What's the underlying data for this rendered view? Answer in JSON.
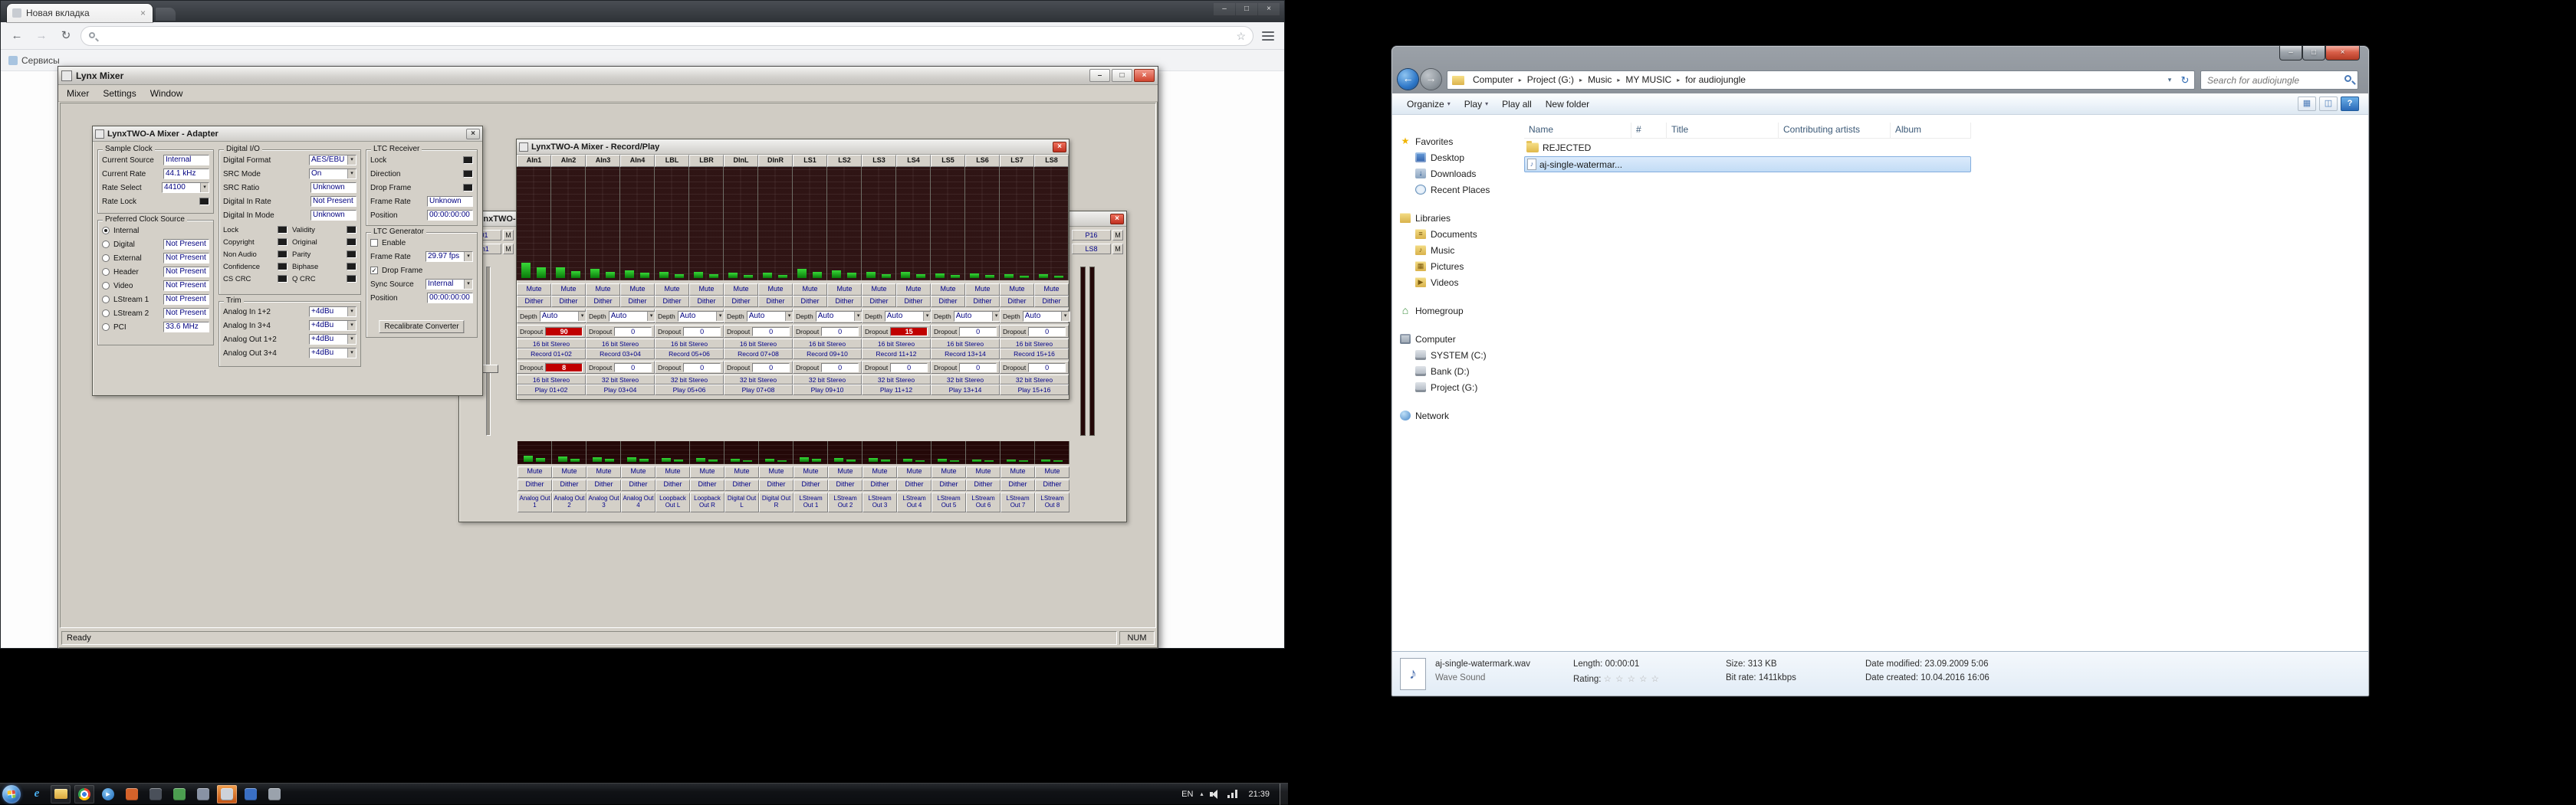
{
  "icons": {
    "close": "×",
    "minimize": "–",
    "maximize": "□",
    "back": "←",
    "forward": "→",
    "refresh": "↻",
    "star": "☆",
    "dropdown": "▾",
    "crumb_sep": "▸",
    "tray_chevron": "▴",
    "check": "✓",
    "note": "♪"
  },
  "browser": {
    "tab_title": "Новая вкладка",
    "bookmark": "Сервисы",
    "address_value": ""
  },
  "mixer": {
    "title": "Lynx Mixer",
    "menu": [
      "Mixer",
      "Settings",
      "Window"
    ],
    "status": {
      "ready": "Ready",
      "num": "NUM"
    },
    "adapter": {
      "title": "LynxTWO-A Mixer - Adapter",
      "groups": {
        "sample_clock": {
          "title": "Sample Clock",
          "rows": [
            {
              "label": "Current Source",
              "value": "Internal",
              "kind": "box"
            },
            {
              "label": "Current Rate",
              "value": "44.1 kHz",
              "kind": "box"
            },
            {
              "label": "Rate Select",
              "value": "44100",
              "kind": "combo"
            },
            {
              "label": "Rate Lock",
              "kind": "led"
            }
          ]
        },
        "preferred": {
          "title": "Preferred Clock Source",
          "rows": [
            {
              "label": "Internal",
              "kind": "radio",
              "selected": true
            },
            {
              "label": "Digital",
              "kind": "radio",
              "value": "Not Present"
            },
            {
              "label": "External",
              "kind": "radio",
              "value": "Not Present"
            },
            {
              "label": "Header",
              "kind": "radio",
              "value": "Not Present"
            },
            {
              "label": "Video",
              "kind": "radio",
              "value": "Not Present"
            },
            {
              "label": "LStream 1",
              "kind": "radio",
              "value": "Not Present"
            },
            {
              "label": "LStream 2",
              "kind": "radio",
              "value": "Not Present"
            },
            {
              "label": "PCI",
              "kind": "radio",
              "value": "33.6 MHz"
            }
          ]
        },
        "digital_io": {
          "title": "Digital I/O",
          "rows": [
            {
              "label": "Digital Format",
              "value": "AES/EBU",
              "kind": "combo"
            },
            {
              "label": "SRC Mode",
              "value": "On",
              "kind": "combo"
            },
            {
              "label": "SRC Ratio",
              "value": "Unknown",
              "kind": "box"
            },
            {
              "label": "Digital In Rate",
              "value": "Not Present",
              "kind": "box"
            },
            {
              "label": "Digital In Mode",
              "value": "Unknown",
              "kind": "box"
            }
          ],
          "leds": [
            [
              "Lock",
              "Validity"
            ],
            [
              "Copyright",
              "Original"
            ],
            [
              "Non Audio",
              "Parity"
            ],
            [
              "Confidence",
              "Biphase"
            ],
            [
              "CS CRC",
              "Q CRC"
            ]
          ]
        },
        "trim": {
          "title": "Trim",
          "rows": [
            {
              "label": "Analog In 1+2",
              "value": "+4dBu",
              "kind": "combo"
            },
            {
              "label": "Analog In 3+4",
              "value": "+4dBu",
              "kind": "combo"
            },
            {
              "label": "Analog Out 1+2",
              "value": "+4dBu",
              "kind": "combo"
            },
            {
              "label": "Analog Out 3+4",
              "value": "+4dBu",
              "kind": "combo"
            }
          ]
        },
        "ltc_receiver": {
          "title": "LTC Receiver",
          "rows": [
            {
              "label": "Lock",
              "kind": "led"
            },
            {
              "label": "Direction",
              "kind": "led"
            },
            {
              "label": "Drop Frame",
              "kind": "led"
            },
            {
              "label": "Frame Rate",
              "value": "Unknown",
              "kind": "box"
            },
            {
              "label": "Position",
              "value": "00:00:00:00",
              "kind": "box"
            }
          ]
        },
        "ltc_generator": {
          "title": "LTC Generator",
          "rows": [
            {
              "label": "Enable",
              "kind": "check",
              "checked": false
            },
            {
              "label": "Frame Rate",
              "value": "29.97 fps",
              "kind": "combo"
            },
            {
              "label": "Drop Frame",
              "kind": "check",
              "checked": true
            },
            {
              "label": "Sync Source",
              "value": "Internal",
              "kind": "combo"
            },
            {
              "label": "Position",
              "value": "00:00:00:00",
              "kind": "box"
            }
          ],
          "button": "Recalibrate Converter"
        }
      }
    },
    "record_play": {
      "title": "LynxTWO-A Mixer - Record/Play",
      "channels": [
        "AIn1",
        "AIn2",
        "AIn3",
        "AIn4",
        "LBL",
        "LBR",
        "DInL",
        "DInR",
        "LS1",
        "LS2",
        "LS3",
        "LS4",
        "LS5",
        "LS6",
        "LS7",
        "LS8"
      ],
      "meter_levels": [
        20,
        14,
        12,
        10,
        8,
        8,
        7,
        7,
        12,
        10,
        8,
        8,
        6,
        6,
        5,
        5
      ],
      "mute_label": "Mute",
      "dither_label": "Dither",
      "depth_label": "Depth",
      "depth_value": "Auto",
      "dropout_label": "Dropout",
      "record": {
        "dropouts": [
          "90",
          "0",
          "0",
          "0",
          "0",
          "15",
          "0",
          "0"
        ],
        "alerts": [
          true,
          false,
          false,
          false,
          false,
          true,
          false,
          false
        ],
        "formats": [
          "16 bit Stereo",
          "16 bit Stereo",
          "16 bit Stereo",
          "16 bit Stereo",
          "16 bit Stereo",
          "16 bit Stereo",
          "16 bit Stereo",
          "16 bit Stereo"
        ],
        "pairs": [
          "Record 01+02",
          "Record 03+04",
          "Record 05+06",
          "Record 07+08",
          "Record 09+10",
          "Record 11+12",
          "Record 13+14",
          "Record 15+16"
        ]
      },
      "play": {
        "dropouts": [
          "8",
          "0",
          "0",
          "0",
          "0",
          "0",
          "0",
          "0"
        ],
        "alerts": [
          true,
          false,
          false,
          false,
          false,
          false,
          false,
          false
        ],
        "formats": [
          "16 bit Stereo",
          "32 bit Stereo",
          "32 bit Stereo",
          "32 bit Stereo",
          "32 bit Stereo",
          "32 bit Stereo",
          "32 bit Stereo",
          "32 bit Stereo"
        ],
        "pairs": [
          "Play 01+02",
          "Play 03+04",
          "Play 05+06",
          "Play 07+08",
          "Play 09+10",
          "Play 11+12",
          "Play 13+14",
          "Play 15+16"
        ]
      }
    },
    "outputs": {
      "title": "LynxTWO-A Mixer",
      "left_tags": [
        "P01",
        "AIn1"
      ],
      "right_tags": [
        "P16",
        "LS8"
      ],
      "m_label": "M",
      "mute_label": "Mute",
      "dither_label": "Dither",
      "labels": [
        "Analog Out 1",
        "Analog Out 2",
        "Analog Out 3",
        "Analog Out 4",
        "Loopback Out L",
        "Loopback Out R",
        "Digital Out L",
        "Digital Out R",
        "LStream Out 1",
        "LStream Out 2",
        "LStream Out 3",
        "LStream Out 4",
        "LStream Out 5",
        "LStream Out 6",
        "LStream Out 7",
        "LStream Out 8"
      ],
      "meter_levels": [
        8,
        7,
        6,
        6,
        5,
        5,
        4,
        4,
        6,
        5,
        5,
        4,
        4,
        3,
        3,
        3
      ]
    }
  },
  "explorer": {
    "breadcrumb": [
      "Computer",
      "Project (G:)",
      "Music",
      "MY MUSIC",
      "for audiojungle"
    ],
    "search_placeholder": "Search for audiojungle",
    "toolbar": {
      "organize": "Organize",
      "play": "Play",
      "play_all": "Play all",
      "new_folder": "New folder"
    },
    "columns": [
      "Name",
      "#",
      "Title",
      "Contributing artists",
      "Album"
    ],
    "items": [
      {
        "name": "REJECTED",
        "icon": "folder",
        "selected": false
      },
      {
        "name": "aj-single-watermar...",
        "icon": "audio",
        "selected": true
      }
    ],
    "nav": [
      {
        "label": "Favorites",
        "icon": "star",
        "level": 0
      },
      {
        "label": "Desktop",
        "icon": "desktop",
        "level": 1
      },
      {
        "label": "Downloads",
        "icon": "downloads",
        "level": 1
      },
      {
        "label": "Recent Places",
        "icon": "recent",
        "level": 1
      },
      {
        "label": "Libraries",
        "icon": "library",
        "level": 0,
        "gap": true
      },
      {
        "label": "Documents",
        "icon": "fold-docs",
        "level": 1
      },
      {
        "label": "Music",
        "icon": "fold-music",
        "level": 1
      },
      {
        "label": "Pictures",
        "icon": "fold-pics",
        "level": 1
      },
      {
        "label": "Videos",
        "icon": "fold-videos",
        "level": 1
      },
      {
        "label": "Homegroup",
        "icon": "home",
        "level": 0,
        "gap": true
      },
      {
        "label": "Computer",
        "icon": "computer",
        "level": 0,
        "gap": true
      },
      {
        "label": "SYSTEM (C:)",
        "icon": "drive",
        "level": 1
      },
      {
        "label": "Bank (D:)",
        "icon": "drive",
        "level": 1
      },
      {
        "label": "Project (G:)",
        "icon": "drive",
        "level": 1
      },
      {
        "label": "Network",
        "icon": "network",
        "level": 0,
        "gap": true
      }
    ],
    "details": {
      "name": "aj-single-watermark.wav",
      "type": "Wave Sound",
      "length": "Length: 00:00:01",
      "rating": "Rating:",
      "stars": "☆ ☆ ☆ ☆ ☆",
      "size": "Size: 313 KB",
      "bitrate": "Bit rate: 1411kbps",
      "modified": "Date modified: 23.09.2009 5:06",
      "created": "Date created: 10.04.2016 16:06"
    }
  },
  "taskbar": {
    "lang": "EN",
    "clock": "21:39",
    "icons": [
      {
        "name": "internet-explorer",
        "kind": "ie",
        "glyph": "e"
      },
      {
        "name": "file-explorer",
        "kind": "folder",
        "state": "running"
      },
      {
        "name": "chrome",
        "kind": "chrome",
        "state": "running"
      },
      {
        "name": "media-player",
        "kind": "player",
        "glyph": "▶"
      },
      {
        "name": "app-orange",
        "kind": "sq",
        "color": "#d4622a"
      },
      {
        "name": "app-dark",
        "kind": "sq",
        "color": "#4a505a"
      },
      {
        "name": "app-green",
        "kind": "sq",
        "color": "#4c9e50"
      },
      {
        "name": "app-slate",
        "kind": "sq",
        "color": "#8892a4"
      },
      {
        "name": "lynx-mixer",
        "kind": "sq",
        "color": "#cdd2da",
        "state": "attention"
      },
      {
        "name": "app-blue",
        "kind": "sq",
        "color": "#3a6fc4"
      },
      {
        "name": "app-gray",
        "kind": "sq",
        "color": "#9aa2ac"
      }
    ]
  }
}
